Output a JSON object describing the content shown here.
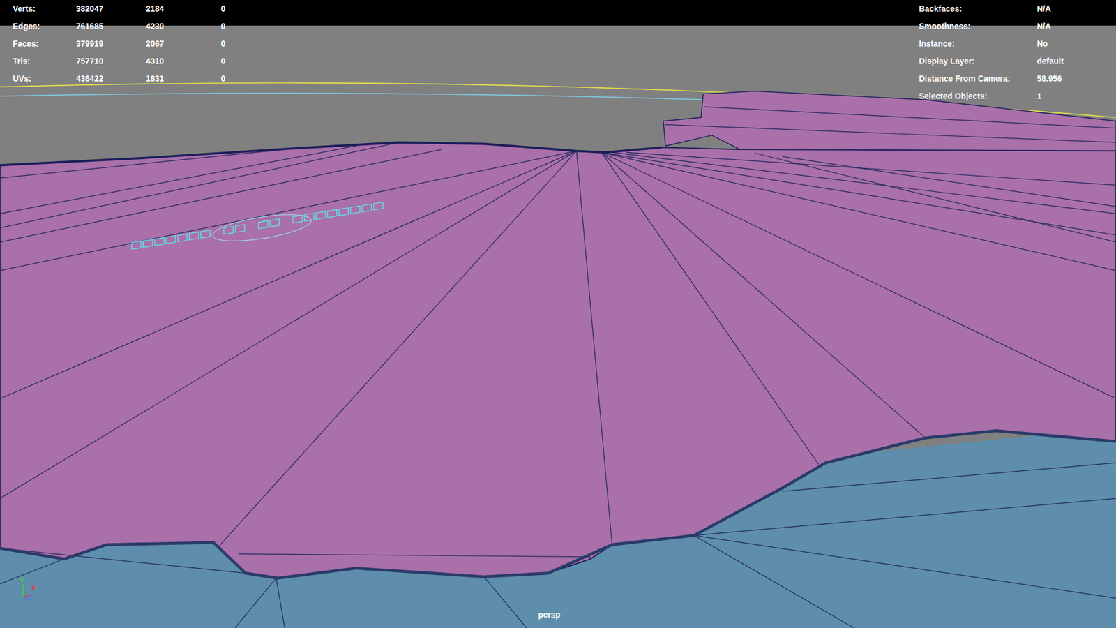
{
  "hud_left": [
    {
      "label": "Verts:",
      "values": [
        "382047",
        "2184",
        "0"
      ]
    },
    {
      "label": "Edges:",
      "values": [
        "761685",
        "4230",
        "0"
      ]
    },
    {
      "label": "Faces:",
      "values": [
        "379919",
        "2067",
        "0"
      ]
    },
    {
      "label": "Tris:",
      "values": [
        "757710",
        "4310",
        "0"
      ]
    },
    {
      "label": "UVs:",
      "values": [
        "436422",
        "1831",
        "0"
      ]
    }
  ],
  "hud_right": [
    {
      "label": "Backfaces:",
      "value": "N/A"
    },
    {
      "label": "Smoothness:",
      "value": "N/A"
    },
    {
      "label": "Instance:",
      "value": "No"
    },
    {
      "label": "Display Layer:",
      "value": "default"
    },
    {
      "label": "Distance From Camera:",
      "value": "58.956"
    },
    {
      "label": "Selected Objects:",
      "value": "1"
    }
  ],
  "axes": [
    {
      "label": "Y",
      "color": "#3fd13f"
    },
    {
      "label": "X",
      "color": "#e04040"
    },
    {
      "label": "Z",
      "color": "#4a6fe0"
    }
  ],
  "camera": "persp"
}
